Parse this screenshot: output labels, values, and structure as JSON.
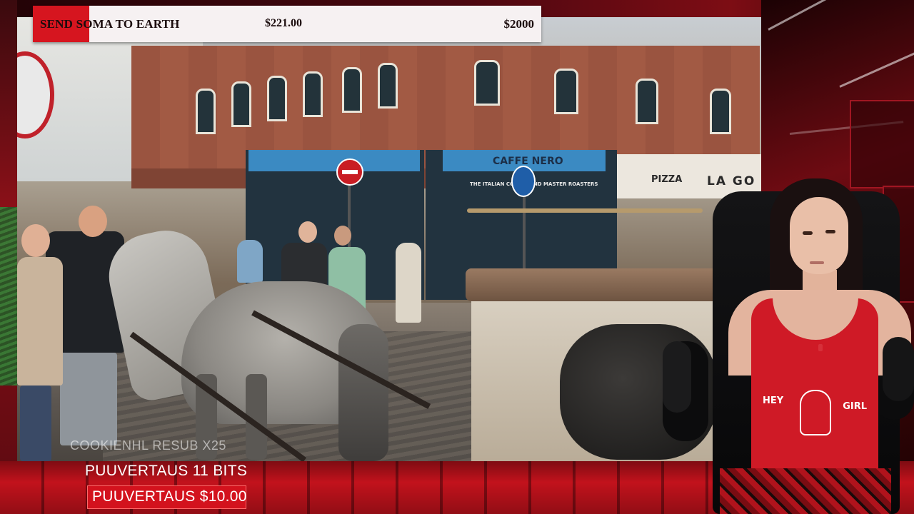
{
  "goal": {
    "title": "SEND SOMA TO EARTH",
    "current": "$221.00",
    "target": "$2000",
    "progress": 0.1105
  },
  "alerts": {
    "ghost_line": "COOKIENHL  RESUB X25",
    "bits_line": "PUUVERTAUS  11 BITS",
    "donation_line": "PUUVERTAUS  $10.00"
  },
  "video": {
    "shop_sign_1": "CAFFE NERO",
    "shop_sign_2": "THE ITALIAN COFFEE AND MASTER ROASTERS",
    "shop_sign_3": "PIZZA",
    "shop_sign_4": "LA GO",
    "shirt_text_1": "HEY",
    "shirt_text_2": "GIRL"
  },
  "colors": {
    "accent_red": "#d6151f",
    "goal_bg": "#f6f1f2",
    "text_dark": "#1b0c0d"
  }
}
